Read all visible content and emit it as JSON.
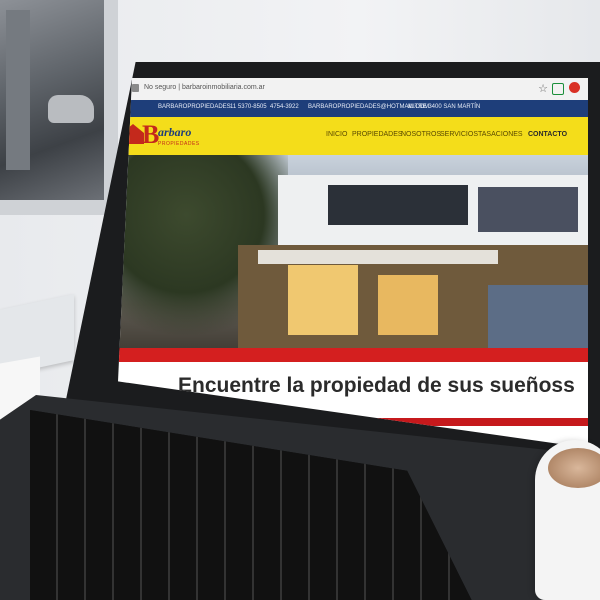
{
  "browser": {
    "url": "No seguro | barbaroinmobiliaria.com.ar"
  },
  "topbar": {
    "items": [
      {
        "label": "BARBAROPROPIEDADES"
      },
      {
        "label": "11 5370-8505"
      },
      {
        "label": "4754-3922"
      },
      {
        "label": "BARBAROPROPIEDADES@HOTMAIL.COM"
      },
      {
        "label": "MITRE 3400 SAN MARTÍN"
      }
    ]
  },
  "logo": {
    "letter": "B",
    "name": "arbaro",
    "subtitle": "PROPIEDADES"
  },
  "nav": {
    "items": [
      {
        "label": "INICIO"
      },
      {
        "label": "PROPIEDADES"
      },
      {
        "label": "NOSOTROS"
      },
      {
        "label": "SERVICIOS"
      },
      {
        "label": "TASACIONES"
      },
      {
        "label": "CONTACTO"
      }
    ]
  },
  "hero": {
    "tagline": "Encuentre la propiedad de sus sueñoss"
  },
  "colors": {
    "topbar": "#1e3e7a",
    "navbar": "#f4dd1a",
    "accent_red": "#d41f1f"
  }
}
